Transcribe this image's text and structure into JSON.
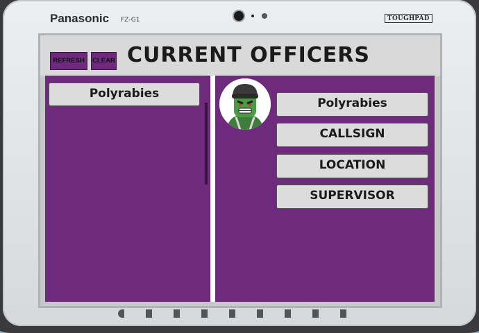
{
  "device": {
    "brand": "Panasonic",
    "model": "FZ-G1",
    "badge": "TOUGHPAD"
  },
  "header": {
    "refresh_label": "REFRESH",
    "clear_label": "CLEAR",
    "title": "CURRENT OFFICERS"
  },
  "officer_list": {
    "items": [
      {
        "label": "Polyrabies"
      }
    ]
  },
  "details": {
    "name": "Polyrabies",
    "callsign": "CALLSIGN",
    "location": "LOCATION",
    "supervisor": "SUPERVISOR"
  },
  "colors": {
    "panel": "#6e2b7e",
    "button": "#dcdcdc",
    "header": "#d9d9d9"
  },
  "icons": {
    "avatar": "officer-avatar-icon"
  }
}
